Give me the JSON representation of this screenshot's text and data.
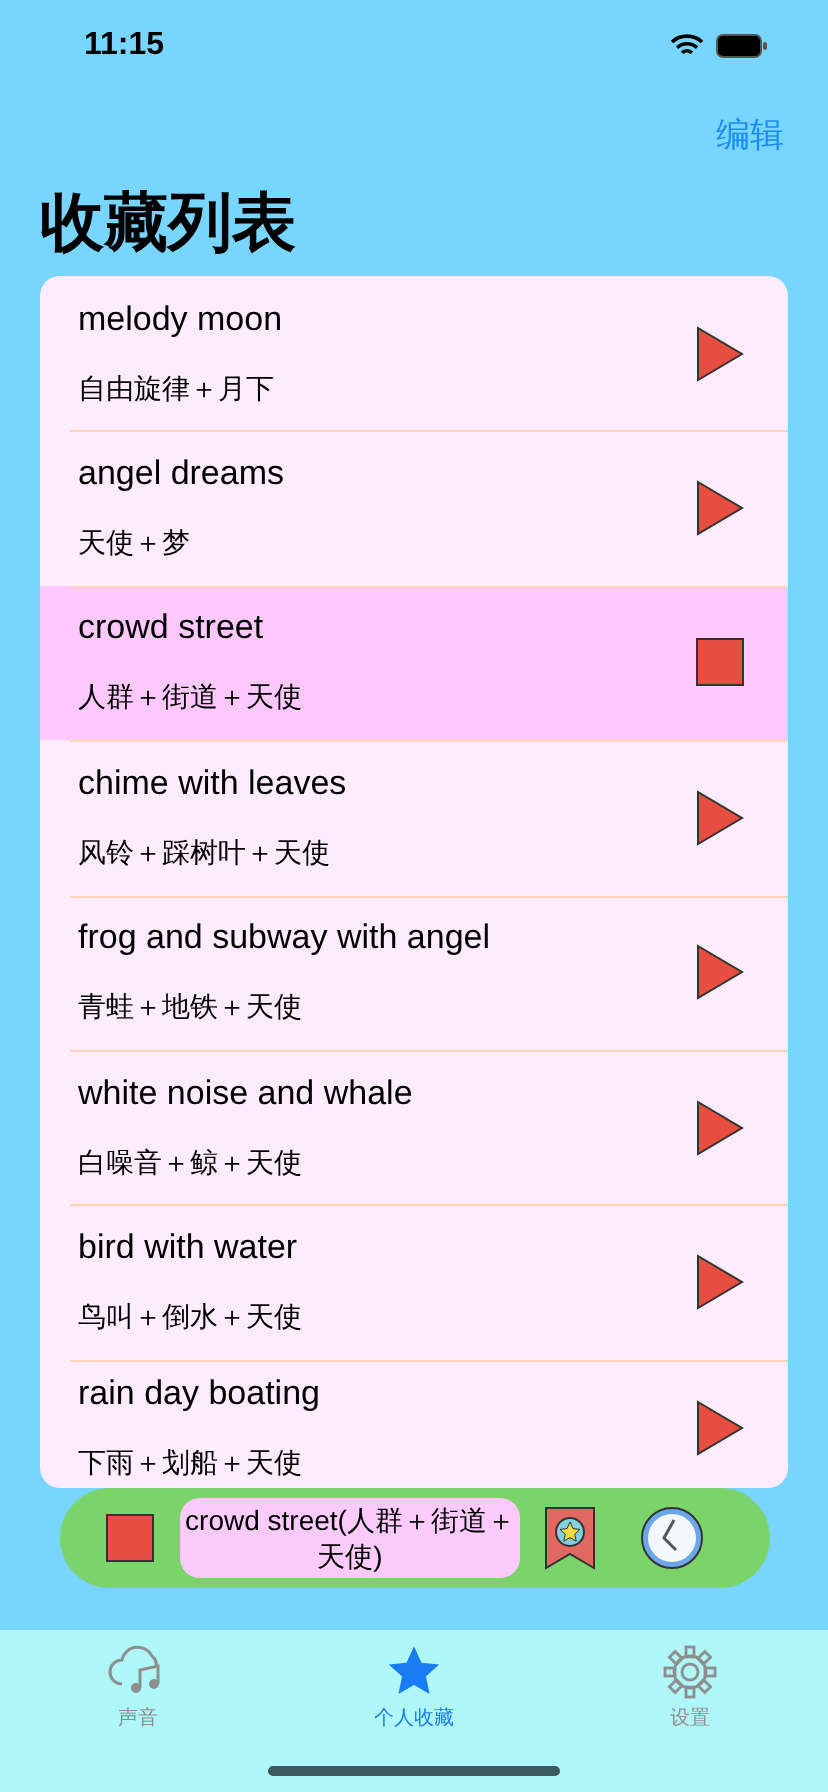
{
  "status_bar": {
    "time": "11:15"
  },
  "nav": {
    "edit": "编辑",
    "title": "收藏列表"
  },
  "favorites": [
    {
      "title": "melody moon",
      "subtitle": "自由旋律＋月下",
      "selected": false
    },
    {
      "title": "angel dreams",
      "subtitle": "天使＋梦",
      "selected": false
    },
    {
      "title": "crowd street",
      "subtitle": "人群＋街道＋天使",
      "selected": true
    },
    {
      "title": "chime with leaves",
      "subtitle": "风铃＋踩树叶＋天使",
      "selected": false
    },
    {
      "title": "frog and subway with angel",
      "subtitle": "青蛙＋地铁＋天使",
      "selected": false
    },
    {
      "title": "white noise and whale",
      "subtitle": "白噪音＋鲸＋天使",
      "selected": false
    },
    {
      "title": "bird with water",
      "subtitle": "鸟叫＋倒水＋天使",
      "selected": false
    },
    {
      "title": "rain day boating",
      "subtitle": "下雨＋划船＋天使",
      "selected": false
    }
  ],
  "player": {
    "now_playing": "crowd street(人群＋街道＋天使)"
  },
  "tab_bar": [
    {
      "label": "声音",
      "kind": "sounds",
      "selected": false
    },
    {
      "label": "个人收藏",
      "kind": "favorites",
      "selected": true
    },
    {
      "label": "设置",
      "kind": "settings",
      "selected": false
    }
  ]
}
